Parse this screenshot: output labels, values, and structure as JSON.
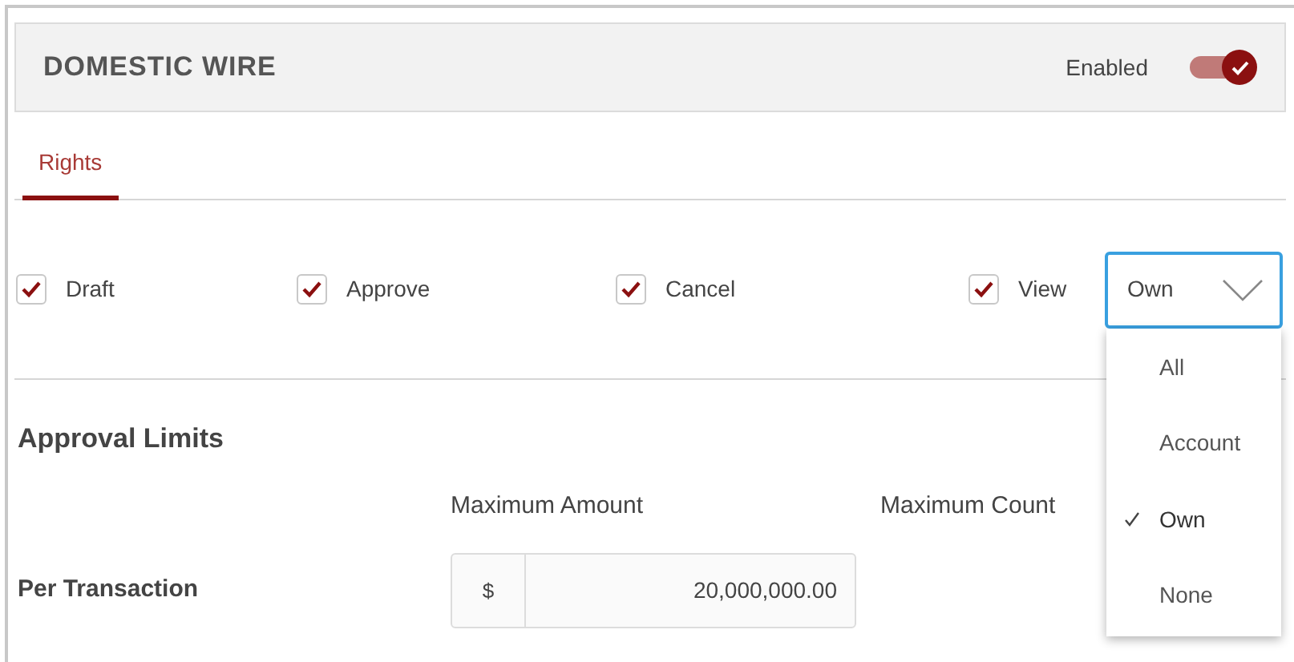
{
  "header": {
    "title": "DOMESTIC WIRE",
    "toggle_label": "Enabled",
    "enabled": true
  },
  "tabs": [
    {
      "label": "Rights",
      "selected": true
    }
  ],
  "rights": [
    {
      "label": "Draft",
      "checked": true
    },
    {
      "label": "Approve",
      "checked": true
    },
    {
      "label": "Cancel",
      "checked": true
    },
    {
      "label": "View",
      "checked": true
    }
  ],
  "view_scope": {
    "value": "Own",
    "expanded": true,
    "options": [
      {
        "label": "All",
        "selected": false
      },
      {
        "label": "Account",
        "selected": false
      },
      {
        "label": "Own",
        "selected": true
      },
      {
        "label": "None",
        "selected": false
      }
    ]
  },
  "approval_limits": {
    "title": "Approval Limits",
    "columns": [
      "Maximum Amount",
      "Maximum Count"
    ],
    "rows": [
      {
        "label": "Per Transaction",
        "currency": "$",
        "amount": "20,000,000.00"
      }
    ]
  }
}
